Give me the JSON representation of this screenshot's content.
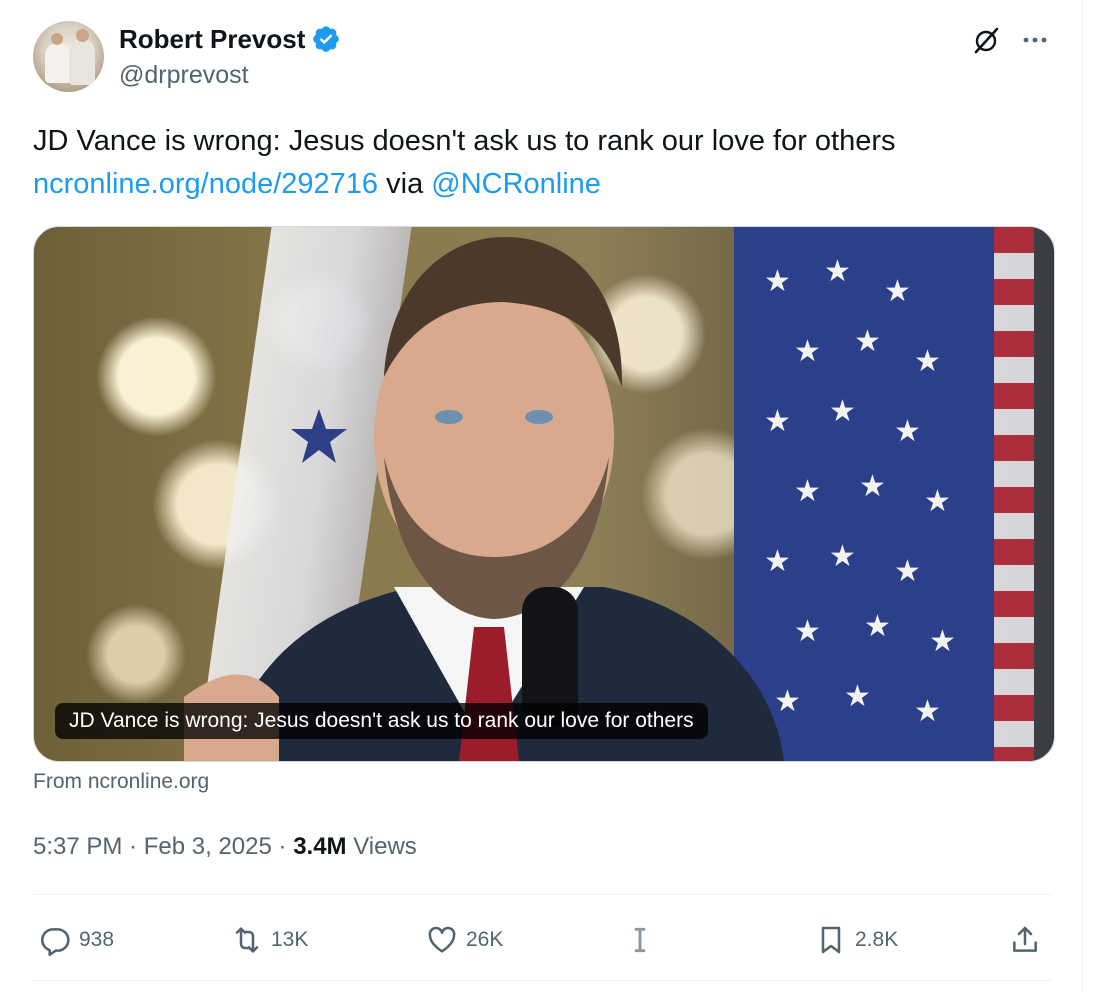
{
  "author": {
    "name": "Robert Prevost",
    "handle": "@drprevost",
    "verified": true
  },
  "tweet": {
    "text_line1": "JD Vance is wrong: Jesus doesn't ask us to rank our love for others",
    "link_text": "ncronline.org/node/292716",
    "via_text": "via",
    "mention": "@NCRonline"
  },
  "card": {
    "caption": "JD Vance is wrong: Jesus doesn't ask us to rank our love for others",
    "source": "From ncronline.org"
  },
  "meta": {
    "time": "5:37 PM",
    "separator": "·",
    "date": "Feb 3, 2025",
    "views_count": "3.4M",
    "views_label": "Views"
  },
  "actions": {
    "replies": "938",
    "reposts": "13K",
    "likes": "26K",
    "bookmarks": "2.8K"
  },
  "icons": {
    "verified": "verified-badge-icon",
    "grok": "grok-icon",
    "more": "more-icon",
    "reply": "reply-icon",
    "repost": "repost-icon",
    "like": "heart-icon",
    "analytics": "analytics-icon",
    "bookmark": "bookmark-icon",
    "share": "share-icon"
  },
  "colors": {
    "link": "#1d9bf0",
    "verified": "#1d9bf0",
    "secondary_text": "#536471",
    "primary_text": "#0f1419"
  }
}
